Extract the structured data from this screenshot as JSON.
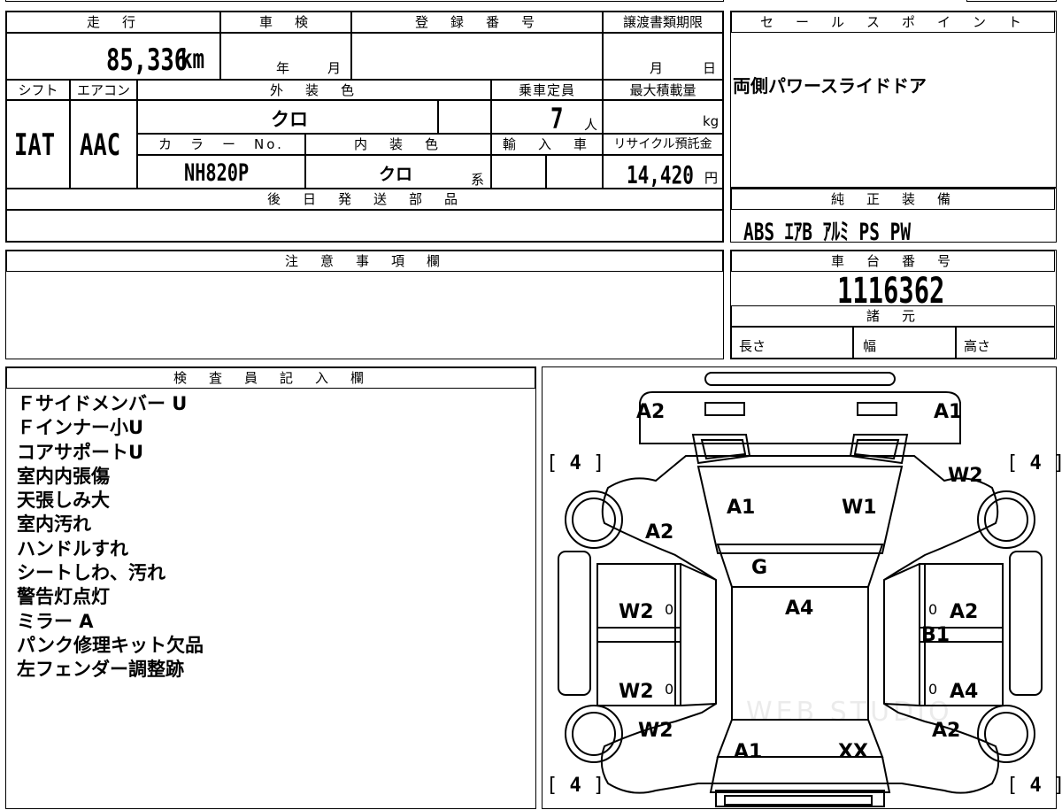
{
  "top_info": {
    "mileage_header": "走　行",
    "mileage_value": "85,336",
    "mileage_unit": "km",
    "inspection_header": "車　検",
    "inspection_year_label": "年",
    "inspection_month_label": "月",
    "registration_header": "登　録　番　号",
    "transfer_header": "譲渡書類期限",
    "transfer_month_label": "月",
    "transfer_day_label": "日",
    "shift_header": "シフト",
    "shift_value": "IAT",
    "ac_header": "エアコン",
    "ac_value": "AAC",
    "exterior_color_header": "外　装　色",
    "exterior_color_value": "クロ",
    "capacity_header": "乗車定員",
    "capacity_value": "7",
    "capacity_unit": "人",
    "max_load_header": "最大積載量",
    "max_load_unit": "kg",
    "color_no_header": "カ　ラ　ー　No.",
    "color_no_value": "NH820P",
    "interior_color_header": "内　装　色",
    "interior_color_value": "クロ",
    "interior_color_suffix": "系",
    "import_header": "輸　入　車",
    "recycle_header": "リサイクル預託金",
    "recycle_value": "14,420",
    "recycle_unit": "円",
    "later_parts_header": "後　日　発　送　部　品"
  },
  "sales_point": {
    "header": "セ　ー　ル　ス　ポ　イ　ン　ト",
    "text": "両側パワースライドドア"
  },
  "standard_equipment": {
    "header": "純　正　装　備",
    "text": "ABS  ｴｱB  ｱﾙﾐ  PS  PW"
  },
  "notes": {
    "header": "注　意　事　項　欄"
  },
  "chassis": {
    "header": "車　台　番　号",
    "value": "1116362",
    "specs_header": "諸　元",
    "length_label": "長さ",
    "width_label": "幅",
    "height_label": "高さ"
  },
  "inspector": {
    "header": "検　査　員　記　入　欄",
    "lines": [
      "Ｆサイドメンバー U",
      "Ｆインナー小U",
      "コアサポートU",
      "室内内張傷",
      "天張しみ大",
      "室内汚れ",
      "ハンドルすれ",
      "シートしわ、汚れ",
      "警告灯点灯",
      "ミラー A",
      "パンク修理キット欠品",
      "左フェンダー調整跡"
    ]
  },
  "diagram": {
    "marks": {
      "front_left_corner": "A2",
      "front_right_corner": "A1",
      "hood_left": "A1",
      "hood_right": "W1",
      "left_front_fender": "A2",
      "windshield": "G",
      "roof": "A4",
      "left_front_door": "W2",
      "left_rear_door": "W2",
      "left_rear_fender": "W2",
      "right_front_fender": "W2",
      "right_front_door": "A2",
      "right_pillar": "B1",
      "right_rear_door": "A4",
      "right_rear_fender": "A2",
      "rear_left": "A1",
      "rear_right": "XX"
    },
    "zero_marks": [
      "0",
      "0",
      "0",
      "0"
    ],
    "tire_labels": [
      "4",
      "4",
      "4",
      "4"
    ],
    "watermark": "WEB STUDIO"
  }
}
